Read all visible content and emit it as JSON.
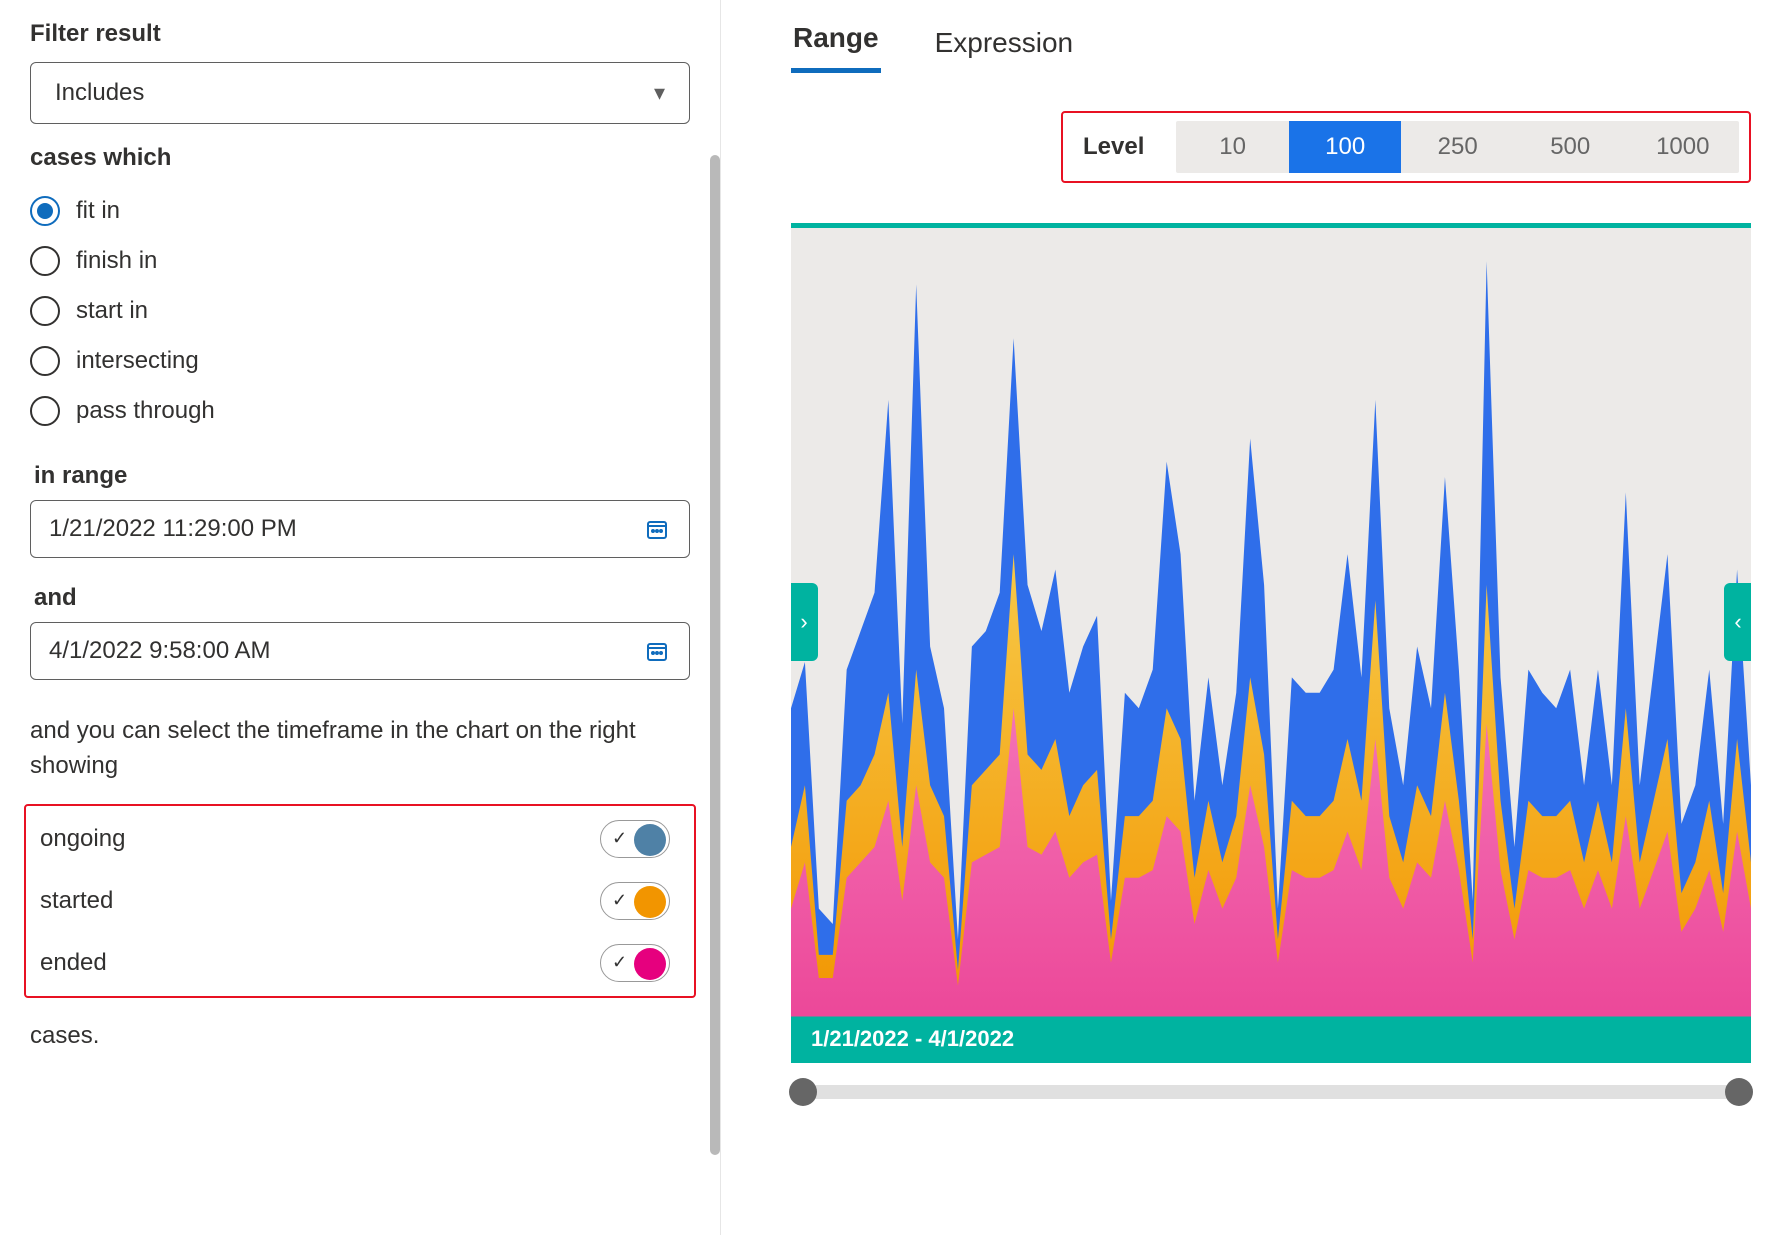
{
  "left": {
    "filter_result_label": "Filter result",
    "filter_select_value": "Includes",
    "cases_which_label": "cases which",
    "radios": [
      {
        "label": "fit in",
        "checked": true
      },
      {
        "label": "finish in",
        "checked": false
      },
      {
        "label": "start in",
        "checked": false
      },
      {
        "label": "intersecting",
        "checked": false
      },
      {
        "label": "pass through",
        "checked": false
      }
    ],
    "in_range_label": "in range",
    "date_from": "1/21/2022 11:29:00 PM",
    "and_label": "and",
    "date_to": "4/1/2022 9:58:00 AM",
    "description": "and you can select the timeframe in the chart on the right showing",
    "toggles": [
      {
        "label": "ongoing",
        "color": "blue",
        "on": true
      },
      {
        "label": "started",
        "color": "orange",
        "on": true
      },
      {
        "label": "ended",
        "color": "pink",
        "on": true
      }
    ],
    "trailing": "cases."
  },
  "right": {
    "tabs": [
      {
        "label": "Range",
        "active": true
      },
      {
        "label": "Expression",
        "active": false
      }
    ],
    "level_label": "Level",
    "level_options": [
      {
        "label": "10",
        "active": false
      },
      {
        "label": "100",
        "active": true
      },
      {
        "label": "250",
        "active": false
      },
      {
        "label": "500",
        "active": false
      },
      {
        "label": "1000",
        "active": false
      }
    ],
    "chart_caption": "1/21/2022 - 4/1/2022"
  },
  "chart_data": {
    "type": "area",
    "title": "",
    "xlabel": "",
    "ylabel": "",
    "x_range": [
      "1/21/2022",
      "4/1/2022"
    ],
    "ylim": [
      0,
      100
    ],
    "series": [
      {
        "name": "ongoing",
        "color": "#2f6eea",
        "values": [
          40,
          46,
          14,
          12,
          45,
          50,
          55,
          80,
          38,
          95,
          48,
          40,
          10,
          48,
          50,
          55,
          88,
          56,
          50,
          58,
          42,
          48,
          52,
          15,
          42,
          40,
          45,
          72,
          60,
          28,
          44,
          30,
          42,
          75,
          56,
          14,
          44,
          42,
          42,
          45,
          60,
          44,
          80,
          40,
          30,
          48,
          40,
          70,
          45,
          15,
          98,
          44,
          22,
          45,
          42,
          40,
          45,
          30,
          45,
          30,
          68,
          30,
          45,
          60,
          25,
          30,
          45,
          25,
          58,
          30
        ]
      },
      {
        "name": "started",
        "color": "#f29500",
        "values": [
          22,
          30,
          8,
          8,
          28,
          30,
          34,
          42,
          22,
          45,
          30,
          26,
          6,
          30,
          32,
          34,
          60,
          34,
          32,
          36,
          26,
          30,
          32,
          10,
          26,
          26,
          28,
          40,
          36,
          18,
          28,
          20,
          26,
          44,
          34,
          10,
          28,
          26,
          26,
          28,
          36,
          28,
          54,
          26,
          20,
          30,
          26,
          42,
          28,
          10,
          56,
          28,
          14,
          28,
          26,
          26,
          28,
          20,
          28,
          20,
          40,
          20,
          28,
          36,
          16,
          20,
          28,
          16,
          36,
          20
        ]
      },
      {
        "name": "ended",
        "color": "#ec4899",
        "values": [
          14,
          20,
          5,
          5,
          18,
          20,
          22,
          28,
          15,
          30,
          20,
          18,
          4,
          20,
          21,
          22,
          40,
          22,
          21,
          24,
          18,
          20,
          21,
          7,
          18,
          18,
          19,
          26,
          24,
          12,
          19,
          14,
          18,
          30,
          22,
          7,
          19,
          18,
          18,
          19,
          24,
          19,
          36,
          18,
          14,
          20,
          18,
          28,
          19,
          7,
          38,
          19,
          10,
          19,
          18,
          18,
          19,
          14,
          19,
          14,
          26,
          14,
          19,
          24,
          11,
          14,
          19,
          11,
          24,
          14
        ]
      }
    ]
  }
}
